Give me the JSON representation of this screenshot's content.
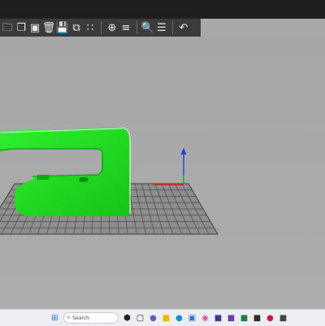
{
  "toolbar": {
    "buttons": [
      {
        "name": "open-project-icon",
        "glyph": "🗀"
      },
      {
        "name": "copy-icon",
        "glyph": "❐"
      },
      {
        "name": "paste-icon",
        "glyph": "▣"
      },
      {
        "name": "delete-icon",
        "glyph": "🗑"
      },
      {
        "name": "save-icon",
        "glyph": "💾"
      },
      {
        "name": "duplicate-icon",
        "glyph": "⧉"
      },
      {
        "name": "grid-icon",
        "glyph": "∷"
      },
      {
        "name": "move-icon",
        "glyph": "⊕"
      },
      {
        "name": "align-icon",
        "glyph": "≡"
      },
      {
        "name": "zoom-icon",
        "glyph": "🔍"
      },
      {
        "name": "layers-icon",
        "glyph": "☰"
      },
      {
        "name": "undo-icon",
        "glyph": "↶"
      }
    ]
  },
  "viewport": {
    "model_color": "#20dc20",
    "grid_color": "#4b4b4b",
    "axes": {
      "x_color": "#e02020",
      "y_color": "#20c020",
      "z_color": "#1a3fe0"
    }
  },
  "taskbar": {
    "search_placeholder": "Search",
    "apps": [
      {
        "name": "start-icon",
        "glyph": "⊞",
        "color": "#1a73e8"
      },
      {
        "name": "search-icon",
        "glyph": "⌕",
        "color": "#222"
      },
      {
        "name": "widgets-icon",
        "glyph": "⬢",
        "color": "#222"
      },
      {
        "name": "task-view-icon",
        "glyph": "▢",
        "color": "#333"
      },
      {
        "name": "chat-icon",
        "glyph": "●",
        "color": "#5b5fc7"
      },
      {
        "name": "file-explorer-icon",
        "glyph": "■",
        "color": "#f2b600"
      },
      {
        "name": "edge-icon",
        "glyph": "●",
        "color": "#0f8ed8"
      },
      {
        "name": "store-icon",
        "glyph": "▣",
        "color": "#2f6fd0"
      },
      {
        "name": "photos-icon",
        "glyph": "◉",
        "color": "#d94fa0"
      },
      {
        "name": "app-icon",
        "glyph": "■",
        "color": "#3a3a8c"
      },
      {
        "name": "slicer-icon",
        "glyph": "■",
        "color": "#6b3fa0"
      },
      {
        "name": "excel-icon",
        "glyph": "■",
        "color": "#1e7b45"
      },
      {
        "name": "app2-icon",
        "glyph": "■",
        "color": "#2c2c2c"
      },
      {
        "name": "raspberry-icon",
        "glyph": "●",
        "color": "#c51a4a"
      },
      {
        "name": "app3-icon",
        "glyph": "■",
        "color": "#444"
      }
    ]
  }
}
